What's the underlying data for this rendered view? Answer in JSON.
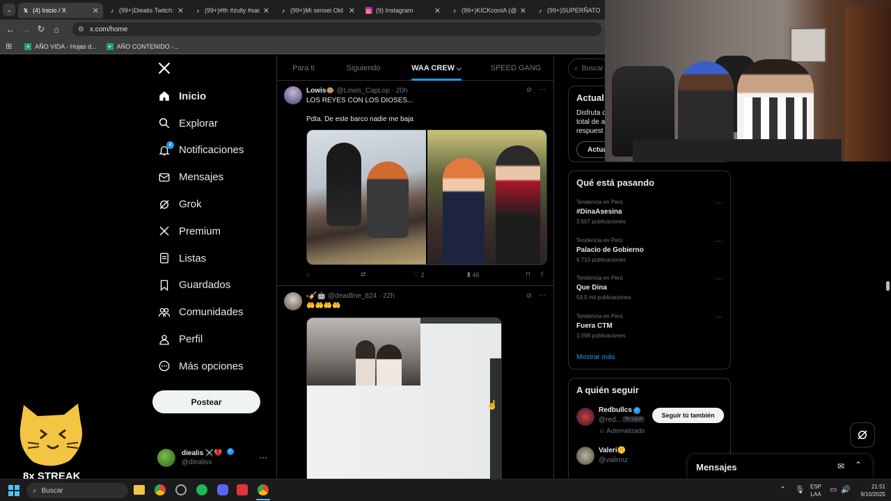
{
  "browser": {
    "tabs": [
      {
        "title": "(4) Inicio / X",
        "icon": "x-logo",
        "active": true
      },
      {
        "title": "(99+)Diealis Twitch: L",
        "icon": "tiktok-icon"
      },
      {
        "title": "(99+)#th #zully #sach",
        "icon": "tiktok-icon"
      },
      {
        "title": "(99+)Mi sensei Old F",
        "icon": "tiktok-icon"
      },
      {
        "title": "(9) Instagram",
        "icon": "instagram-icon"
      },
      {
        "title": "(99+)KICKconIA (@k",
        "icon": "tiktok-icon"
      },
      {
        "title": "(99+)SUPERÑATO.wa",
        "icon": "tiktok-icon"
      }
    ],
    "url": "x.com/home",
    "bookmarks": [
      "AÑO VIDA - Hojas d...",
      "AÑO CONTENIDO -..."
    ]
  },
  "nav": {
    "items": [
      {
        "label": "Inicio",
        "icon": "home-icon"
      },
      {
        "label": "Explorar",
        "icon": "search-icon"
      },
      {
        "label": "Notificaciones",
        "icon": "bell-icon",
        "badge": "4"
      },
      {
        "label": "Mensajes",
        "icon": "mail-icon"
      },
      {
        "label": "Grok",
        "icon": "grok-icon"
      },
      {
        "label": "Premium",
        "icon": "x-icon"
      },
      {
        "label": "Listas",
        "icon": "list-icon"
      },
      {
        "label": "Guardados",
        "icon": "bookmark-icon"
      },
      {
        "label": "Comunidades",
        "icon": "people-icon"
      },
      {
        "label": "Perfil",
        "icon": "person-icon"
      },
      {
        "label": "Más opciones",
        "icon": "more-icon"
      }
    ],
    "post_label": "Postear",
    "account": {
      "name": "diealis ⚔️💔",
      "handle": "@diealiss"
    }
  },
  "feed": {
    "tabs": [
      "Para ti",
      "Siguiendo",
      "WAA CREW",
      "SPEED GANG"
    ],
    "active_tab": "WAA CREW",
    "tweets": [
      {
        "name": "Lowis🐵",
        "handle": "@Lowis_CapLop",
        "time": "· 20h",
        "text1": "LOS REYES CON LOS DIOSES...",
        "text2": "Pdta. De este barco nadie me baja",
        "likes": "2",
        "views": "46"
      },
      {
        "name": "-🎸🤖",
        "handle": "@deadline_824",
        "time": "· 22h",
        "text1": "🤲🤲🤲🤲"
      }
    ]
  },
  "right": {
    "search_placeholder": "Buscar",
    "premium": {
      "title": "Actual",
      "line1": "Disfruta d",
      "line2": "total de a",
      "line3": "respuest",
      "button": "Actua"
    },
    "trends_title": "Qué está pasando",
    "trends": [
      {
        "context": "Tendencia en Perú",
        "name": "#DinaAsesina",
        "count": "3.507 publicaciones"
      },
      {
        "context": "Tendencia en Perú",
        "name": "Palacio de Gobierno",
        "count": "6.710 publicaciones"
      },
      {
        "context": "Tendencia en Perú",
        "name": "Que Dina",
        "count": "59,5 mil publicaciones"
      },
      {
        "context": "Tendencia en Perú",
        "name": "Fuera CTM",
        "count": "1.098 publicaciones"
      }
    ],
    "show_more": "Mostrar más",
    "follow_title": "A quién seguir",
    "follow": [
      {
        "name": "Redbullcs",
        "handle": "@red...",
        "tag": "Te sigue",
        "note": "Automatizado",
        "button": "Seguir tú también"
      },
      {
        "name": "Valeri🤫",
        "handle": "@valirmz"
      }
    ]
  },
  "messages_drawer": {
    "title": "Mensajes"
  },
  "overlay": {
    "streak": "8x STREAK"
  },
  "taskbar": {
    "search": "Buscar",
    "lang1": "ESP",
    "lang2": "LAA",
    "time": "21:51",
    "date": "9/10/2025"
  },
  "colors": {
    "accent": "#1d9bf0",
    "bg": "#000000",
    "border": "#2f3336",
    "muted": "#71767b"
  }
}
